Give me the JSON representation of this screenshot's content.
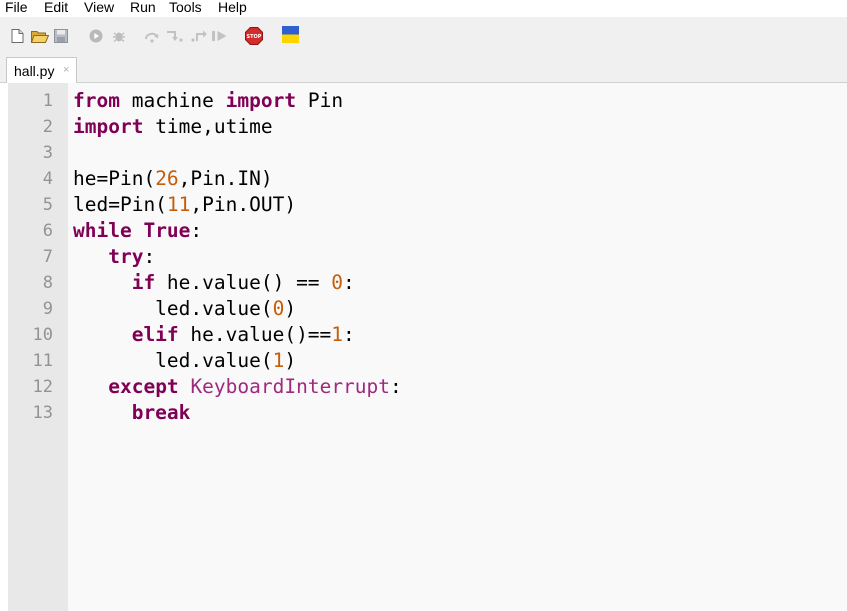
{
  "menu": [
    "File",
    "Edit",
    "View",
    "Run",
    "Tools",
    "Help"
  ],
  "toolbar": {
    "icons": [
      "new-file-icon",
      "open-folder-icon",
      "save-icon",
      "run-icon",
      "debug-icon",
      "step-over-icon",
      "step-into-icon",
      "step-out-icon",
      "resume-icon",
      "stop-icon",
      "ukraine-flag-icon"
    ],
    "stop_label": "STOP"
  },
  "tab": {
    "label": "hall.py",
    "close": "×"
  },
  "editor": {
    "line_numbers": [
      "1",
      "2",
      "3",
      "4",
      "5",
      "6",
      "7",
      "8",
      "9",
      "10",
      "11",
      "12",
      "13"
    ],
    "lines": [
      [
        {
          "t": "from",
          "c": "kw"
        },
        {
          "t": " machine "
        },
        {
          "t": "import",
          "c": "kw"
        },
        {
          "t": " Pin"
        }
      ],
      [
        {
          "t": "import",
          "c": "kw"
        },
        {
          "t": " time,utime"
        }
      ],
      [],
      [
        {
          "t": "he=Pin("
        },
        {
          "t": "26",
          "c": "num"
        },
        {
          "t": ",Pin.IN)"
        }
      ],
      [
        {
          "t": "led=Pin("
        },
        {
          "t": "11",
          "c": "num"
        },
        {
          "t": ",Pin.OUT)"
        }
      ],
      [
        {
          "t": "while",
          "c": "kw"
        },
        {
          "t": " "
        },
        {
          "t": "True",
          "c": "kw"
        },
        {
          "t": ":"
        }
      ],
      [
        {
          "t": "   "
        },
        {
          "t": "try",
          "c": "kw"
        },
        {
          "t": ":"
        }
      ],
      [
        {
          "t": "     "
        },
        {
          "t": "if",
          "c": "kw"
        },
        {
          "t": " he.value() == "
        },
        {
          "t": "0",
          "c": "num"
        },
        {
          "t": ":"
        }
      ],
      [
        {
          "t": "       led.value("
        },
        {
          "t": "0",
          "c": "num"
        },
        {
          "t": ")"
        }
      ],
      [
        {
          "t": "     "
        },
        {
          "t": "elif",
          "c": "kw"
        },
        {
          "t": " he.value()=="
        },
        {
          "t": "1",
          "c": "num"
        },
        {
          "t": ":"
        }
      ],
      [
        {
          "t": "       led.value("
        },
        {
          "t": "1",
          "c": "num"
        },
        {
          "t": ")"
        }
      ],
      [
        {
          "t": "   "
        },
        {
          "t": "except",
          "c": "kw"
        },
        {
          "t": " "
        },
        {
          "t": "KeyboardInterrupt",
          "c": "cls"
        },
        {
          "t": ":"
        }
      ],
      [
        {
          "t": "     "
        },
        {
          "t": "break",
          "c": "kw"
        }
      ]
    ]
  },
  "colors": {
    "keyword": "#7f0055",
    "number": "#c65d09",
    "class_name": "#9e2a7e",
    "line_number": "#939393",
    "gutter_bg": "#e8e8e8",
    "editor_bg": "#f9f9f9",
    "toolbar_bg": "#f0f0f0"
  }
}
